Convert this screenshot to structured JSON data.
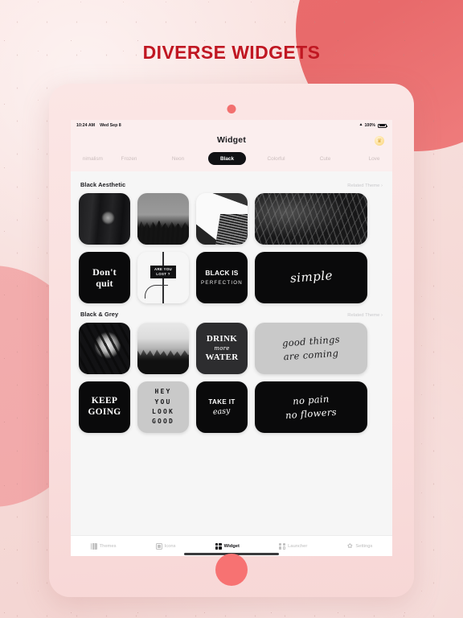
{
  "promo": {
    "headline": "DIVERSE WIDGETS",
    "accent_color": "#c01722",
    "background_color": "#f6dcd9",
    "blob_color": "#eb6c6c"
  },
  "device": {
    "frame_color": "#fadedd",
    "home_button_color": "#f77272",
    "camera_dot": "camera-dot"
  },
  "status_bar": {
    "time": "10:24 AM",
    "date": "Wed Sep 8",
    "wifi_icon": "wifi-icon",
    "battery_percent": "100%",
    "battery_icon": "battery-icon"
  },
  "header": {
    "title": "Widget",
    "premium_badge_icon": "crown-badge-icon",
    "premium_badge_glyph": "♛"
  },
  "categories": [
    {
      "label": "nimalism",
      "active": false,
      "clipped": true
    },
    {
      "label": "Frozen",
      "active": false,
      "clipped": false
    },
    {
      "label": "Neon",
      "active": false,
      "clipped": false
    },
    {
      "label": "Black",
      "active": true,
      "clipped": false
    },
    {
      "label": "Colorful",
      "active": false,
      "clipped": false
    },
    {
      "label": "Cute",
      "active": false,
      "clipped": false
    },
    {
      "label": "Love",
      "active": false,
      "clipped": false
    }
  ],
  "sections": [
    {
      "title": "Black Aesthetic",
      "link": "Related Theme ›",
      "rows": [
        [
          {
            "kind": "photo",
            "style": "ph-window",
            "size": "square",
            "name": "widget-dark-window-photo"
          },
          {
            "kind": "photo",
            "style": "ph-forest",
            "size": "square",
            "name": "widget-forest-silhouette-photo"
          },
          {
            "kind": "photo",
            "style": "ph-skyscraper",
            "size": "square",
            "name": "widget-skyscraper-photo"
          },
          {
            "kind": "photo",
            "style": "ph-waves",
            "size": "wide",
            "name": "widget-dark-waves-photo"
          }
        ],
        [
          {
            "kind": "text",
            "size": "square",
            "bg": "bg-black",
            "name": "widget-dont-quit",
            "lines": [
              {
                "text": "Don't",
                "class": "t-serif-quit"
              },
              {
                "text": "quit",
                "class": "t-serif-quit"
              }
            ]
          },
          {
            "kind": "sign",
            "size": "square",
            "name": "widget-lost-sign-photo",
            "sign_text": "ARE YOU\nLOST ?"
          },
          {
            "kind": "text",
            "size": "square",
            "bg": "bg-black",
            "name": "widget-black-is-perfection",
            "lines": [
              {
                "text": "BLACK IS",
                "class": "t-sans-caps"
              },
              {
                "text": "PERFECTION",
                "class": "t-sans-sub"
              }
            ]
          },
          {
            "kind": "text",
            "size": "wide",
            "bg": "bg-black",
            "name": "widget-simple",
            "lines": [
              {
                "text": "simple",
                "class": "t-script"
              }
            ]
          }
        ]
      ]
    },
    {
      "title": "Black & Grey",
      "link": "Related Theme ›",
      "rows": [
        [
          {
            "kind": "photo",
            "style": "ph-moon",
            "size": "square",
            "name": "widget-moon-photo"
          },
          {
            "kind": "photo",
            "style": "ph-mist",
            "size": "square",
            "name": "widget-misty-forest-photo"
          },
          {
            "kind": "text",
            "size": "square",
            "bg": "bg-dark",
            "name": "widget-drink-more-water",
            "lines": [
              {
                "text": "DRINK",
                "class": "t-drink"
              },
              {
                "text": "more",
                "class": "t-more"
              },
              {
                "text": "WATER",
                "class": "t-drink"
              }
            ]
          },
          {
            "kind": "text",
            "size": "wide",
            "bg": "bg-grey",
            "name": "widget-good-things-are-coming",
            "lines": [
              {
                "text": "good things",
                "class": "t-script-sm t-script-dark"
              },
              {
                "text": "are coming",
                "class": "t-script-sm t-script-dark"
              }
            ]
          }
        ],
        [
          {
            "kind": "text",
            "size": "square",
            "bg": "bg-black",
            "name": "widget-keep-going",
            "lines": [
              {
                "text": "KEEP",
                "class": "t-keep"
              },
              {
                "text": "GOING",
                "class": "t-keep"
              }
            ]
          },
          {
            "kind": "text",
            "size": "square",
            "bg": "bg-grey",
            "name": "widget-hey-you-look-good",
            "lines": [
              {
                "text": "HEY",
                "class": "t-mono-grid"
              },
              {
                "text": "YOU",
                "class": "t-mono-grid"
              },
              {
                "text": "LOOK",
                "class": "t-mono-grid"
              },
              {
                "text": "GOOD",
                "class": "t-mono-grid"
              }
            ]
          },
          {
            "kind": "text",
            "size": "square",
            "bg": "bg-black",
            "name": "widget-take-it-easy",
            "lines": [
              {
                "text": "TAKE IT",
                "class": "t-takeit"
              },
              {
                "text": "easy",
                "class": "t-easy"
              }
            ]
          },
          {
            "kind": "text",
            "size": "wide",
            "bg": "bg-black",
            "name": "widget-no-pain-no-flowers",
            "lines": [
              {
                "text": "no pain",
                "class": "t-script-sm"
              },
              {
                "text": "no flowers",
                "class": "t-script-sm"
              }
            ]
          }
        ]
      ]
    }
  ],
  "bottom_nav": [
    {
      "label": "Themes",
      "icon": "themes-icon",
      "active": false
    },
    {
      "label": "Icons",
      "icon": "icons-icon",
      "active": false
    },
    {
      "label": "Widget",
      "icon": "widget-grid-icon",
      "active": true
    },
    {
      "label": "Launcher",
      "icon": "launcher-icon",
      "active": false
    },
    {
      "label": "Settings",
      "icon": "gear-icon",
      "active": false
    }
  ],
  "gear_glyph": "✿"
}
